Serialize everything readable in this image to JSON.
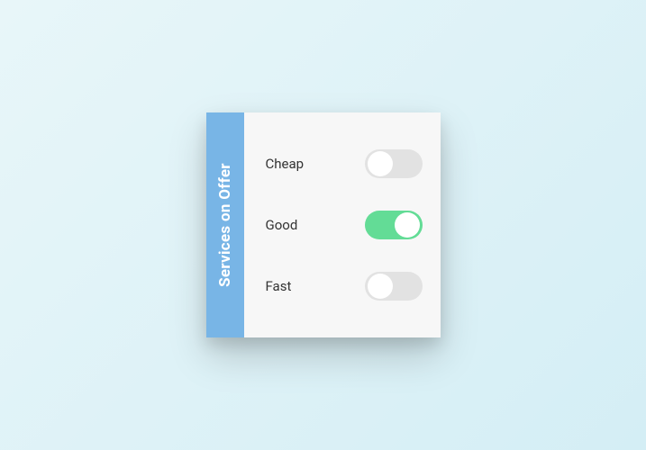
{
  "sidebar": {
    "title": "Services on Offer"
  },
  "toggles": [
    {
      "label": "Cheap",
      "checked": false
    },
    {
      "label": "Good",
      "checked": true
    },
    {
      "label": "Fast",
      "checked": false
    }
  ]
}
